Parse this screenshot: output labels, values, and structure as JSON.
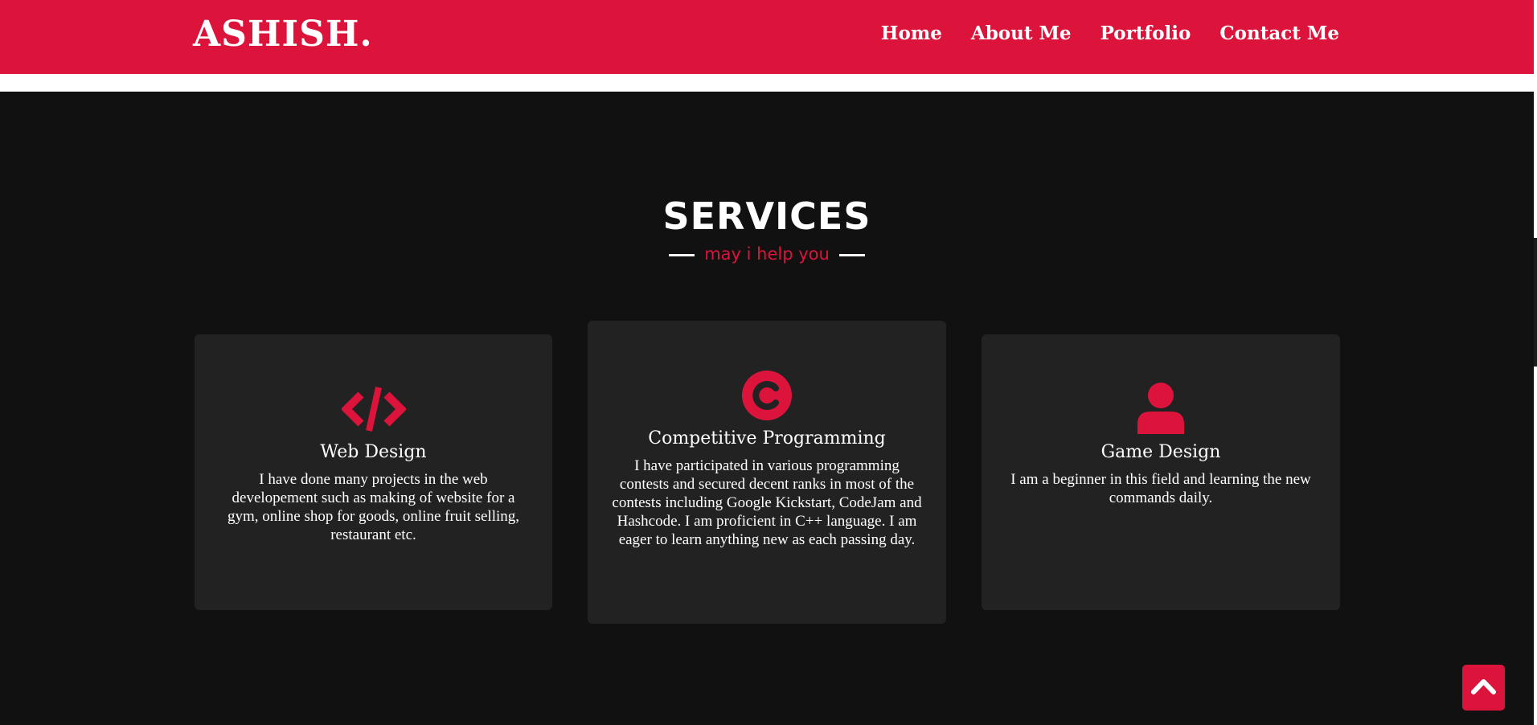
{
  "nav": {
    "logo": "ASHISH.",
    "links": [
      {
        "label": "Home"
      },
      {
        "label": "About Me"
      },
      {
        "label": "Portfolio"
      },
      {
        "label": "Contact Me"
      }
    ]
  },
  "services": {
    "title": "SERVICES",
    "subtitle": "may i help you",
    "cards": [
      {
        "icon": "code-icon",
        "title": "Web Design",
        "text": "I have done many projects in the web developement such as making of website for a gym, online shop for goods, online fruit selling, restaurant etc."
      },
      {
        "icon": "copyright-c-icon",
        "title": "Competitive Programming",
        "text": "I have participated in various programming contests and secured decent ranks in most of the contests including Google Kickstart, CodeJam and Hashcode. I am proficient in C++ language. I am eager to learn anything new as each passing day."
      },
      {
        "icon": "user-icon",
        "title": "Game Design",
        "text": "I am a beginner in this field and learning the new commands daily."
      }
    ]
  },
  "scroll_top": {
    "icon": "chevron-up-icon"
  },
  "colors": {
    "accent": "#dc143c",
    "background": "#111111",
    "card": "#222222",
    "text": "#ffffff"
  }
}
